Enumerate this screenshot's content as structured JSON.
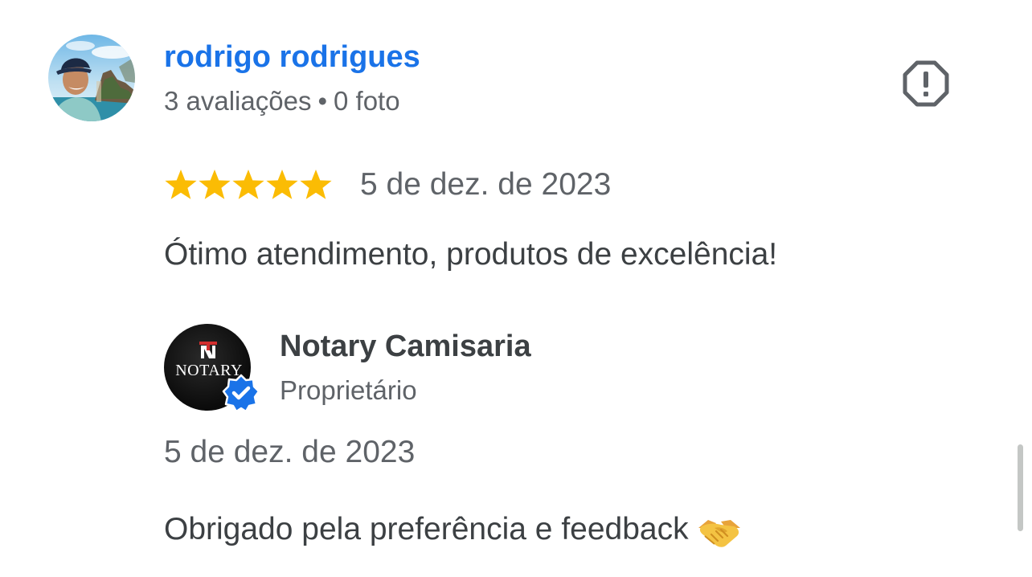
{
  "colors": {
    "link_blue": "#1a73e8",
    "text_primary": "#3c4043",
    "text_secondary": "#5f6368",
    "star_gold": "#fbbc04",
    "verified_blue": "#1a73e8",
    "scrollbar": "#c4c7c5"
  },
  "review": {
    "reviewer_name": "rodrigo rodrigues",
    "reviewer_meta": {
      "reviews": "3 avaliações",
      "separator": "•",
      "photos": "0 foto"
    },
    "rating": 5,
    "rating_max": 5,
    "date": "5 de dez. de 2023",
    "text": "Ótimo atendimento, produtos de excelência!",
    "report_icon": "report-flag-icon"
  },
  "owner_response": {
    "logo_text": "NOTARY",
    "name": "Notary Camisaria",
    "role": "Proprietário",
    "date": "5 de dez. de 2023",
    "text": "Obrigado pela preferência e feedback",
    "emoji_icon": "handshake-icon",
    "badge_icon": "verified-badge-icon"
  },
  "scroll": {
    "position_fraction": 0.85
  }
}
